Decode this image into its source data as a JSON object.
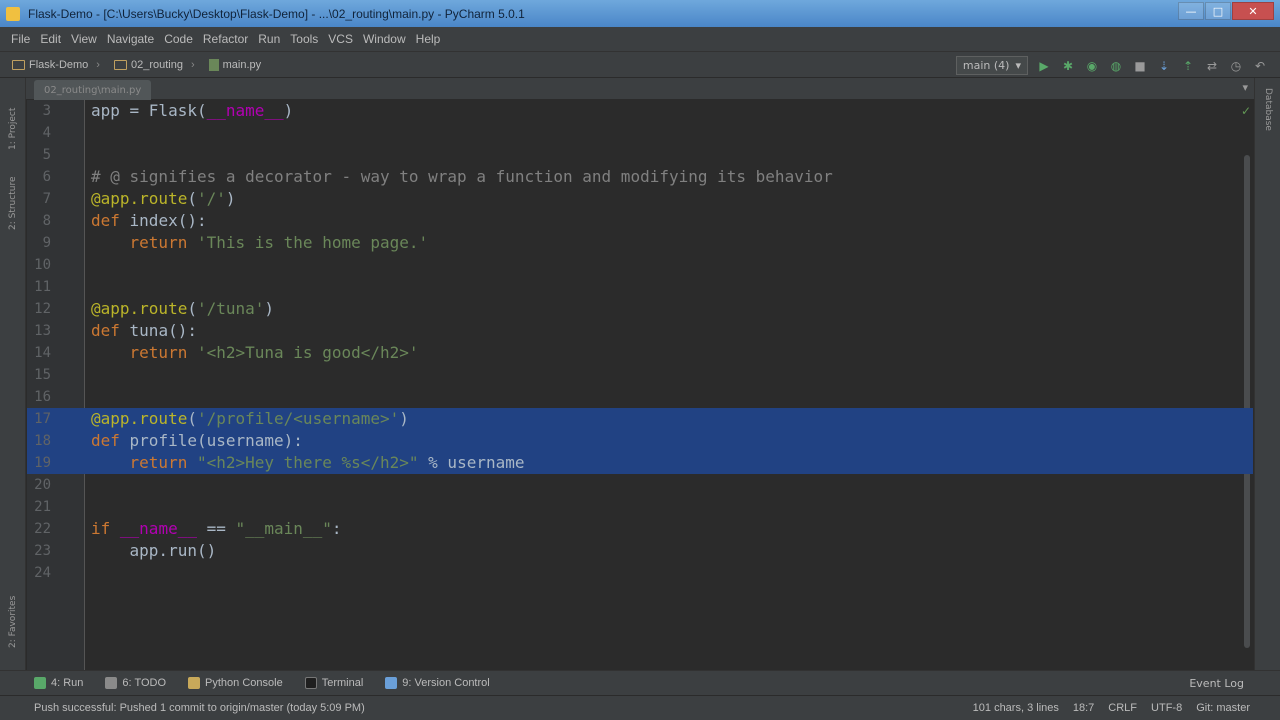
{
  "window": {
    "title": "Flask-Demo - [C:\\Users\\Bucky\\Desktop\\Flask-Demo] - ...\\02_routing\\main.py - PyCharm 5.0.1"
  },
  "menu": [
    "File",
    "Edit",
    "View",
    "Navigate",
    "Code",
    "Refactor",
    "Run",
    "Tools",
    "VCS",
    "Window",
    "Help"
  ],
  "breadcrumb": [
    "Flask-Demo",
    "02_routing",
    "main.py"
  ],
  "toolbar": {
    "run_config": "main (4)"
  },
  "editor": {
    "tab_label": "02_routing\\main.py",
    "lines": [
      {
        "n": "3",
        "t": "app = Flask(__name__)"
      },
      {
        "n": "4",
        "t": ""
      },
      {
        "n": "5",
        "t": ""
      },
      {
        "n": "6",
        "t": "# @ signifies a decorator - way to wrap a function and modifying its behavior"
      },
      {
        "n": "7",
        "t": "@app.route('/')"
      },
      {
        "n": "8",
        "t": "def index():"
      },
      {
        "n": "9",
        "t": "    return 'This is the home page.'"
      },
      {
        "n": "10",
        "t": ""
      },
      {
        "n": "11",
        "t": ""
      },
      {
        "n": "12",
        "t": "@app.route('/tuna')"
      },
      {
        "n": "13",
        "t": "def tuna():"
      },
      {
        "n": "14",
        "t": "    return '<h2>Tuna is good</h2>'"
      },
      {
        "n": "15",
        "t": ""
      },
      {
        "n": "16",
        "t": ""
      },
      {
        "n": "17",
        "t": "@app.route('/profile/<username>')"
      },
      {
        "n": "18",
        "t": "def profile(username):"
      },
      {
        "n": "19",
        "t": "    return \"<h2>Hey there %s</h2>\" % username"
      },
      {
        "n": "20",
        "t": ""
      },
      {
        "n": "21",
        "t": ""
      },
      {
        "n": "22",
        "t": "if __name__ == \"__main__\":"
      },
      {
        "n": "23",
        "t": "    app.run()"
      },
      {
        "n": "24",
        "t": ""
      }
    ],
    "selected_lines": [
      "17",
      "18",
      "19"
    ]
  },
  "tool_windows": [
    "4: Run",
    "6: TODO",
    "Python Console",
    "Terminal",
    "9: Version Control"
  ],
  "event_log": "Event Log",
  "side_panels": {
    "left": [
      "1: Project",
      "2: Structure",
      "2: Favorites"
    ],
    "right": [
      "Database"
    ]
  },
  "status": {
    "message": "Push successful: Pushed 1 commit to origin/master (today 5:09 PM)",
    "chars": "101 chars, 3 lines",
    "position": "18:7",
    "line_sep": "CRLF",
    "encoding": "UTF-8",
    "git": "Git: master"
  },
  "colors": {
    "keyword": "#cc7832",
    "string": "#6a8759",
    "decorator": "#bbb529",
    "comment": "#808080",
    "selection": "#214283"
  }
}
